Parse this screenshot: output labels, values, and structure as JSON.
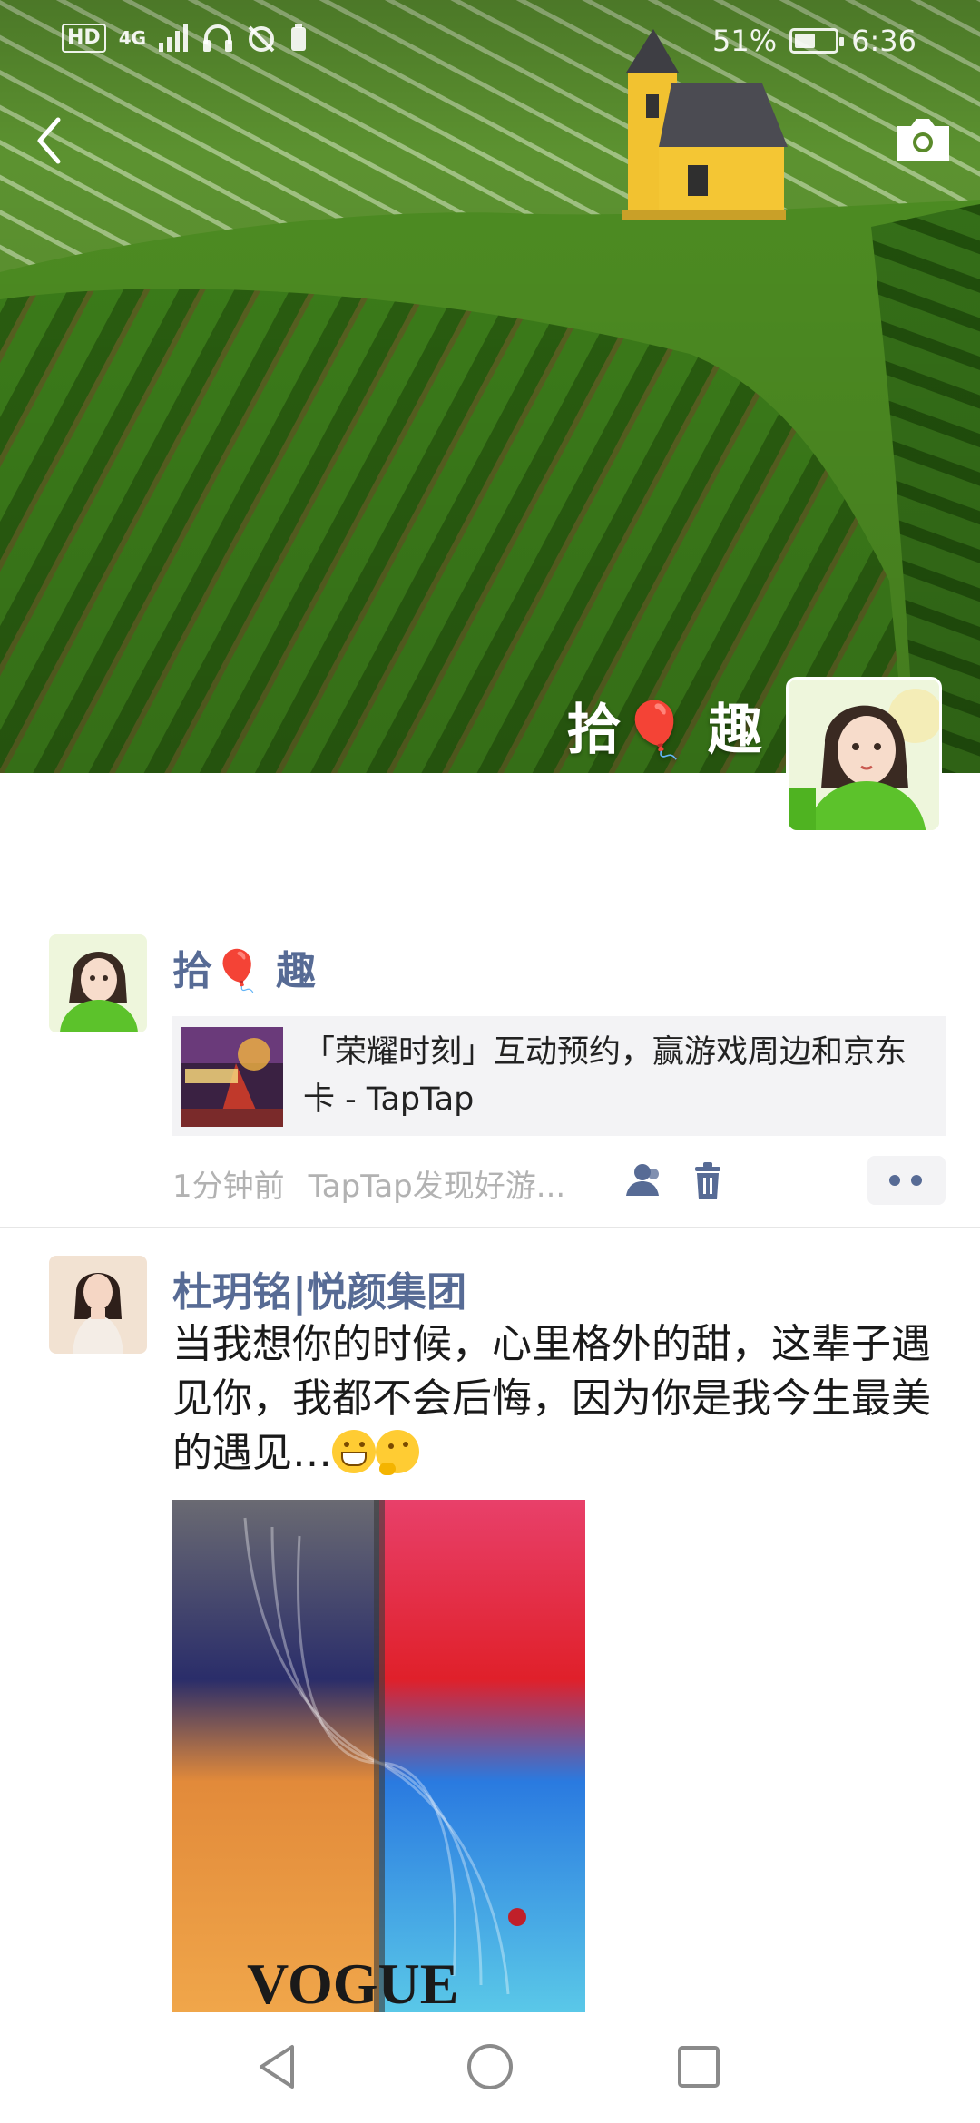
{
  "status_bar": {
    "network_tag": "HD",
    "network_type": "4G",
    "battery_percent": "51%",
    "battery_level": 0.51,
    "time": "6:36"
  },
  "cover": {
    "profile_name": "拾🎈 趣",
    "icons": [
      "back-icon",
      "camera-icon"
    ]
  },
  "posts": [
    {
      "username": "拾🎈 趣",
      "share_card": {
        "title": "「荣耀时刻」互动预约，赢游戏周边和京东卡 - TapTap"
      },
      "time": "1分钟前",
      "source": "TapTap发现好游...",
      "icons": [
        "friends-visibility-icon",
        "trash-icon",
        "more-icon"
      ]
    },
    {
      "username": "杜玥铭|悦颜集团",
      "text": "当我想你的时候，心里格外的甜，这辈子遇见你，我都不会后悔，因为你是我今生最美的遇见…",
      "emojis": [
        "grinning-emoji",
        "thinking-emoji"
      ],
      "image_caption": "VOGUE"
    }
  ],
  "nav_bar": {
    "icons": [
      "nav-back-icon",
      "nav-home-icon",
      "nav-recents-icon"
    ]
  }
}
